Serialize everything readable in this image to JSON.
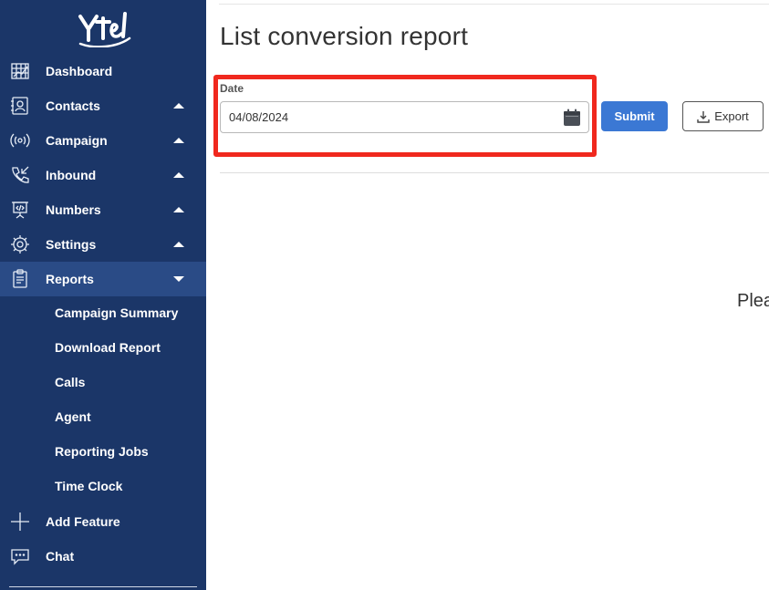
{
  "sidebar": {
    "logo_text": "Ytel",
    "items": [
      {
        "label": "Dashboard",
        "icon": "dashboard-icon",
        "caret": "none"
      },
      {
        "label": "Contacts",
        "icon": "contacts-icon",
        "caret": "up"
      },
      {
        "label": "Campaign",
        "icon": "campaign-icon",
        "caret": "up"
      },
      {
        "label": "Inbound",
        "icon": "inbound-icon",
        "caret": "up"
      },
      {
        "label": "Numbers",
        "icon": "numbers-icon",
        "caret": "up"
      },
      {
        "label": "Settings",
        "icon": "gear-icon",
        "caret": "up"
      },
      {
        "label": "Reports",
        "icon": "reports-icon",
        "caret": "down",
        "active": true
      }
    ],
    "report_subitems": [
      "Campaign Summary",
      "Download Report",
      "Calls",
      "Agent",
      "Reporting Jobs",
      "Time Clock"
    ],
    "bottom_items": [
      {
        "label": "Add Feature",
        "icon": "plus-icon"
      },
      {
        "label": "Chat",
        "icon": "chat-icon"
      }
    ],
    "colors": {
      "background": "#1b3668",
      "active": "#2a4b86"
    }
  },
  "main": {
    "title": "List conversion report",
    "date_label": "Date",
    "date_value": "04/08/2024",
    "submit_label": "Submit",
    "export_label": "Export",
    "placeholder_text": "Plea",
    "colors": {
      "submit": "#3b78d4",
      "highlight": "#f0281e"
    }
  }
}
